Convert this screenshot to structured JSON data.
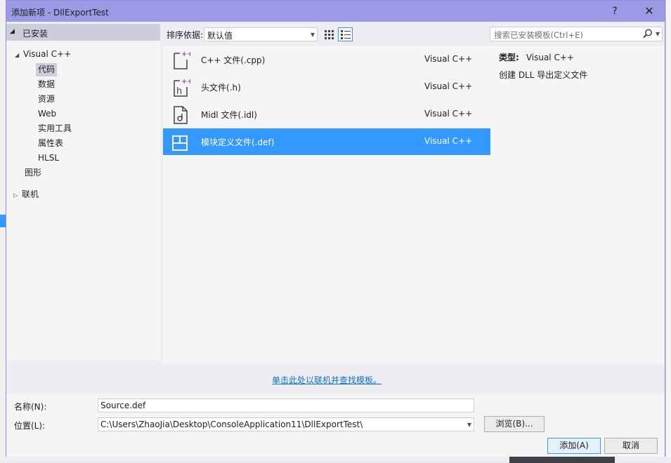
{
  "dialog": {
    "title": "添加新项 - DllExportTest",
    "help_label": "?",
    "close_label": "✕"
  },
  "tree": {
    "header": "已安装",
    "visual_cpp": "Visual C++",
    "children": [
      "代码",
      "数据",
      "资源",
      "Web",
      "实用工具",
      "属性表",
      "HLSL"
    ],
    "graphics": "图形",
    "online": "联机"
  },
  "toolbar": {
    "sort_label": "排序依据:",
    "sort_value": "默认值",
    "search_placeholder": "搜索已安装模板(Ctrl+E)"
  },
  "templates": [
    {
      "name": "C++ 文件(.cpp)",
      "lang": "Visual C++",
      "icon": "cpp-file-icon"
    },
    {
      "name": "头文件(.h)",
      "lang": "Visual C++",
      "icon": "header-file-icon"
    },
    {
      "name": "Midl 文件(.idl)",
      "lang": "Visual C++",
      "icon": "midl-file-icon"
    },
    {
      "name": "模块定义文件(.def)",
      "lang": "Visual C++",
      "icon": "module-def-icon",
      "selected": true
    }
  ],
  "details": {
    "type_label": "类型:",
    "type_value": "Visual C++",
    "description": "创建 DLL 导出定义文件"
  },
  "online_link": "单击此处以联机并查找模板。",
  "form": {
    "name_label": "名称(N):",
    "name_value": "Source.def",
    "location_label": "位置(L):",
    "location_value": "C:\\Users\\ZhaoJia\\Desktop\\ConsoleApplication11\\DllExportTest\\",
    "browse_label": "浏览(B)...",
    "add_label": "添加(A)",
    "cancel_label": "取消"
  },
  "colors": {
    "titlebar": "#9b9be5",
    "selection": "#3399ff",
    "link": "#0e70c0",
    "icon_accent": "#9b4f96"
  }
}
